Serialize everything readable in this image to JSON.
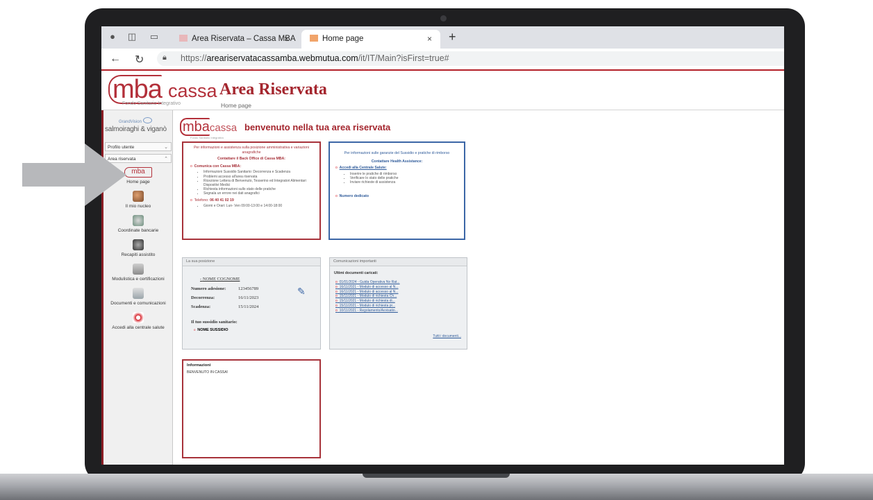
{
  "browser": {
    "tabs": [
      {
        "label": "Area Riservata – Cassa MBA",
        "close": "×"
      },
      {
        "label": "Home page",
        "close": "×"
      }
    ],
    "new_tab": "+",
    "url_host": "areariservatacassamba.webmutua.com",
    "url_prefix": "https://",
    "url_path": "/it/IT/Main?isFirst=true#"
  },
  "header": {
    "logo_mba": "mba",
    "logo_cassa": "cassa",
    "logo_sub": "Fondo Sanitario Integrativo",
    "title": "Area Riservata",
    "subtitle": "Home page"
  },
  "sidebar": {
    "partner_small": "GrandVision",
    "partner_brand": "salmoiraghi & viganò",
    "dropdowns": [
      {
        "label": "Profilo utente",
        "chevron": "⌄"
      },
      {
        "label": "Area riservata",
        "chevron": "⌃"
      }
    ],
    "items": [
      {
        "label": "Home page"
      },
      {
        "label": "Il mio nucleo"
      },
      {
        "label": "Coordinate bancarie"
      },
      {
        "label": "Recapiti assistito"
      },
      {
        "label": "Modulistica e certificazioni"
      },
      {
        "label": "Documenti e comunicazioni"
      },
      {
        "label": "Accedi alla centrale salute"
      }
    ]
  },
  "welcome": {
    "logo_mba": "mba",
    "logo_cassa": "cassa",
    "logo_sub": "Fondo Sanitario Integrativo",
    "text": "benvenuto nella tua area riservata"
  },
  "admin_box": {
    "title": "Per informazioni e assistenza sulla posizione amministrativa e variazioni anagrafiche",
    "contact": "Contattare il Back Office di Cassa MBA:",
    "section1": "Comunica con Cassa MBA:",
    "items": [
      "Informazioni Sussidio Sanitario: Decorrenza e Scadenza",
      "Problemi accesso all'area riservata",
      "Ricezione Lettera di Benvenuto, Tesserino ed Integratori Alimentari Dispositivi Medici",
      "Richiesta informazioni sullo stato delle pratiche",
      "Segnala un errore nei dati anagrafici"
    ],
    "phone_label": "Telefono:",
    "phone": "06 40 41 02 19",
    "hours": "Giorni e Orari: Lun- Ven 09:00-13:00 e 14:00-18:00"
  },
  "health_box": {
    "title": "Per informazioni sulle garanzie del Sussidio e pratiche di rimborso",
    "contact": "Contattare Health Assistance:",
    "section1": "Accedi alla Centrale Salute:",
    "items": [
      "Inserire le pratiche di rimborso",
      "Verificare lo stato delle pratiche",
      "Inviare richieste di assistenza"
    ],
    "section2": "Numero dedicato"
  },
  "position": {
    "header": "La sua posizione",
    "name": "NOME COGNOME",
    "rows": [
      {
        "label": "Numero adesione:",
        "value": "123456789"
      },
      {
        "label": "Decorrenza:",
        "value": "16/11/2023"
      },
      {
        "label": "Scadenza:",
        "value": "15/11/2024"
      }
    ],
    "subsidy_title": "Il tuo sussidio sanitario:",
    "subsidy": "NOME SUSSIDIO"
  },
  "communications": {
    "header": "Comunicazioni importanti",
    "title": "Ultimi documenti caricati:",
    "docs": [
      "01/01/2024 - Guida Operativa No Rat...",
      "16/11/2021 - Modulo di accesso al N...",
      "16/11/2021 - Modulo di accesso al N...",
      "15/11/2021 - Modulo di richiesta Ch...",
      "15/11/2021 - Modulo di richiesta di...",
      "15/11/2021 - Modulo di richiesta pr...",
      "10/11/2021 - Regolamento/Avvisatio..."
    ],
    "all_link": "Tutti i documenti..."
  },
  "info": {
    "title": "Informazioni",
    "text": "BENVENUTO IN CASSA!"
  }
}
